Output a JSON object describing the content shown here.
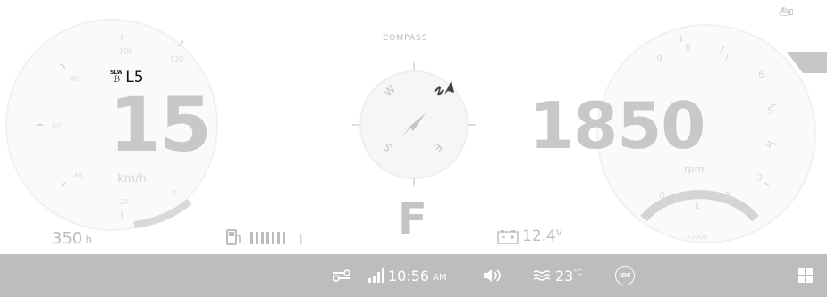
{
  "speedometer": {
    "speed": "15",
    "unit": "km/h",
    "ticks": [
      "0",
      "20",
      "40",
      "60",
      "80",
      "100",
      "120"
    ],
    "gear": "L5",
    "gear_icon": "slow-turtle-icon",
    "gear_icon_label": "SLW"
  },
  "compass": {
    "title": "COMPASS",
    "directions": [
      "N",
      "E",
      "S",
      "W"
    ]
  },
  "tachometer": {
    "rpm": "1850",
    "unit": "rpm",
    "ticks": [
      "0",
      "1",
      "2",
      "3",
      "4",
      "5",
      "6",
      "7",
      "8",
      "9"
    ],
    "multiplier": "X1000"
  },
  "bottom_info": {
    "hours_value": "350",
    "hours_unit": "h",
    "fuel_icon": "fuel-pump-icon",
    "fuel_bars_filled": 7,
    "gear_position": "F",
    "battery_icon": "battery-icon",
    "battery_voltage": "12.4",
    "battery_unit": "V"
  },
  "top_right_icon": "boat-trim-icon",
  "statusbar": {
    "background": "#bdbdbd",
    "settings_icon": "toggle-settings-icon",
    "signal_icon": "signal-bars-icon",
    "time": "10:56",
    "ampm": "AM",
    "volume_icon": "speaker-icon",
    "water_temp_icon": "water-temp-icon",
    "water_temp": "23",
    "water_temp_unit": "°C",
    "brand_label": "IDF",
    "apps_icon": "grid-apps-icon"
  }
}
